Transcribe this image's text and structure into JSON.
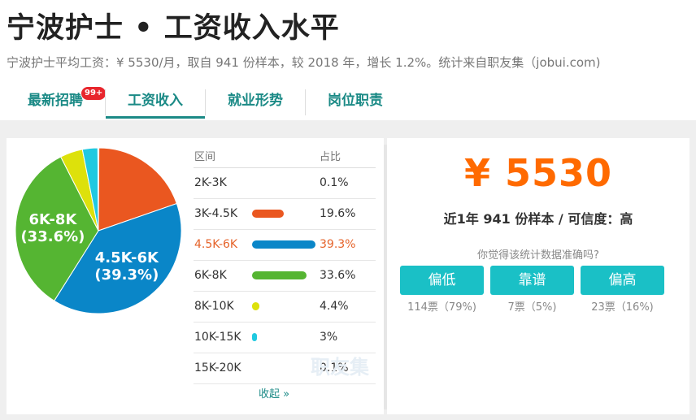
{
  "page": {
    "title": "宁波护士 • 工资收入水平",
    "subtitle": "宁波护士平均工资：¥ 5530/月，取自 941 份样本，较 2018 年，增长 1.2%。统计来自职友集（jobui.com)"
  },
  "tabs": [
    {
      "label": "最新招聘",
      "badge": "99+"
    },
    {
      "label": "工资收入"
    },
    {
      "label": "就业形势"
    },
    {
      "label": "岗位职责"
    }
  ],
  "table": {
    "header_range": "区间",
    "header_pct": "占比",
    "collapse_label": "收起 »"
  },
  "chart_data": {
    "type": "pie",
    "categories": [
      "2K-3K",
      "3K-4.5K",
      "4.5K-6K",
      "6K-8K",
      "8K-10K",
      "10K-15K",
      "15K-20K"
    ],
    "values": [
      0.1,
      19.6,
      39.3,
      33.6,
      4.4,
      3,
      0.1
    ],
    "labels": [
      "0.1%",
      "19.6%",
      "39.3%",
      "33.6%",
      "4.4%",
      "3%",
      "0.1%"
    ],
    "colors": [
      "#2a7fc1",
      "#ea5720",
      "#0a86c8",
      "#55b532",
      "#dde10b",
      "#20c9e0",
      "#999999"
    ],
    "slice_labels": [
      {
        "index": 2,
        "line1": "4.5K-6K",
        "line2": "(39.3%)"
      },
      {
        "index": 3,
        "line1": "6K-8K",
        "line2": "(33.6%)"
      }
    ],
    "highlight_index": 2
  },
  "watermark": "职友集",
  "summary": {
    "salary": "¥ 5530",
    "sample_text": "近1年 941 份样本 / 可信度：高",
    "question": "你觉得该统计数据准确吗?"
  },
  "votes": [
    {
      "label": "偏低",
      "count": "114票（79%)"
    },
    {
      "label": "靠谱",
      "count": "7票（5%)"
    },
    {
      "label": "偏高",
      "count": "23票（16%)"
    }
  ]
}
